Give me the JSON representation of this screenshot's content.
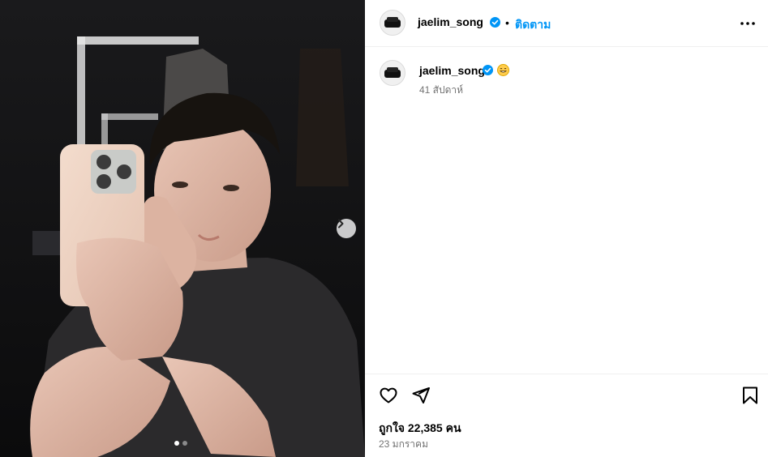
{
  "post": {
    "username": "jaelim_song",
    "follow_label": "ติดตาม",
    "separator": "•",
    "more_icon": "more-horizontal-icon",
    "verified_color": "#0095f6"
  },
  "caption": {
    "username": "jaelim_song",
    "emoji": "grinning-face-emoji",
    "time_ago": "41 สัปดาห์"
  },
  "actions": {
    "like_icon": "heart-icon",
    "share_icon": "paper-plane-icon",
    "save_icon": "bookmark-icon"
  },
  "stats": {
    "likes_text": "ถูกใจ 22,385 คน",
    "date": "23 มกราคม"
  },
  "carousel": {
    "current_slide": 1,
    "total_slides": 2
  }
}
